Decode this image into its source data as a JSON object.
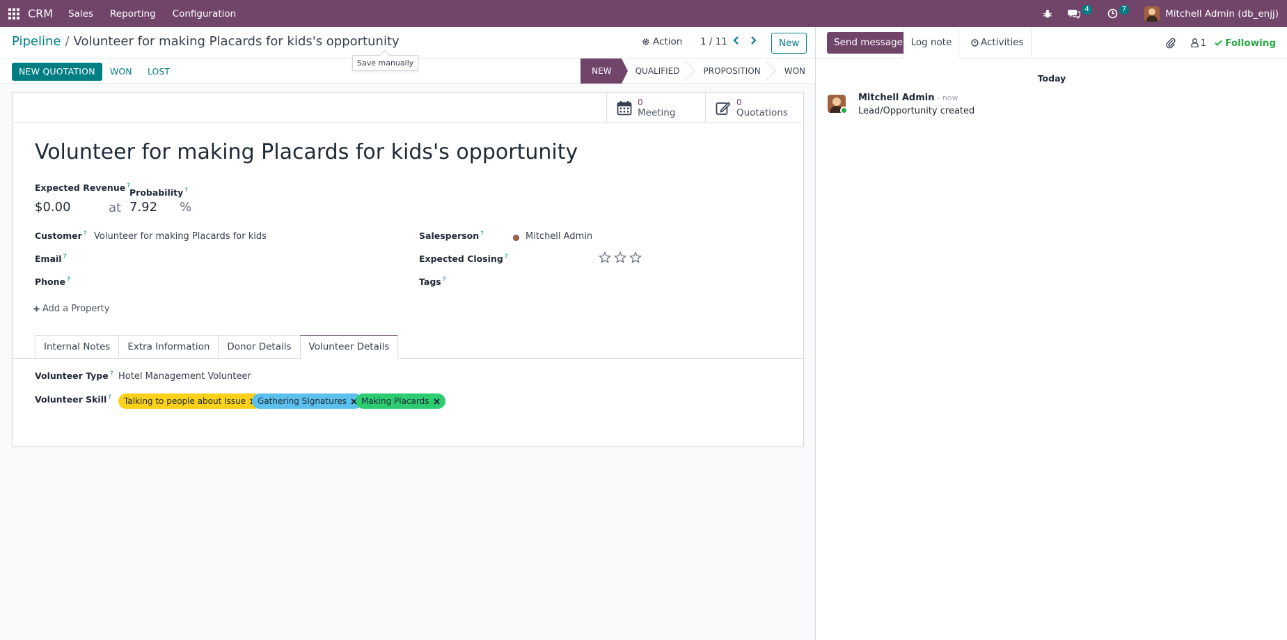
{
  "navbar": {
    "app_name": "CRM",
    "menus": [
      "Sales",
      "Reporting",
      "Configuration"
    ],
    "messages_count": "4",
    "activities_count": "7",
    "user": "Mitchell Admin (db_enjj)"
  },
  "control": {
    "breadcrumb_root": "Pipeline",
    "breadcrumb_separator": "/",
    "breadcrumb_current": "Volunteer for making Placards for kids's opportunity",
    "tooltip": "Save manually",
    "action_label": "Action",
    "pager": "1 / 11",
    "new_label": "New",
    "new_quotation": "NEW QUOTATION",
    "won": "WON",
    "lost": "LOST",
    "stages": [
      "NEW",
      "QUALIFIED",
      "PROPOSITION",
      "WON"
    ]
  },
  "smart_buttons": {
    "meeting_count": "0",
    "meeting_label": "Meeting",
    "quotations_count": "0",
    "quotations_label": "Quotations"
  },
  "form": {
    "title": "Volunteer for making Placards for kids's opportunity",
    "expected_revenue_label": "Expected Revenue",
    "expected_revenue": "$0.00",
    "at": "at",
    "probability_label": "Probability",
    "probability": "7.92",
    "percent": "%",
    "help": "?",
    "customer_label": "Customer",
    "customer": "Volunteer for making Placards for kids",
    "email_label": "Email",
    "phone_label": "Phone",
    "salesperson_label": "Salesperson",
    "salesperson": "Mitchell Admin",
    "expected_closing_label": "Expected Closing",
    "tags_label": "Tags",
    "add_property": "Add a Property",
    "tabs": [
      "Internal Notes",
      "Extra Information",
      "Donor Details",
      "Volunteer Details"
    ],
    "volunteer_type_label": "Volunteer Type",
    "volunteer_type": "Hotel Management Volunteer",
    "volunteer_skill_label": "Volunteer Skill",
    "skills": [
      "Talking to people about Issue",
      "Gathering SIgnatures",
      "Making Placards"
    ]
  },
  "chatter": {
    "send_message": "Send message",
    "log_note": "Log note",
    "activities": "Activities",
    "followers_count": "1",
    "following": "Following",
    "today": "Today",
    "author": "Mitchell Admin",
    "time": "- now",
    "body": "Lead/Opportunity created"
  },
  "colors": {
    "brand": "#71456a",
    "accent": "#017e84",
    "tag_yellow": "#fbd11b",
    "tag_blue": "#5bc0eb",
    "tag_green": "#2ecc71",
    "following": "#28a745"
  }
}
